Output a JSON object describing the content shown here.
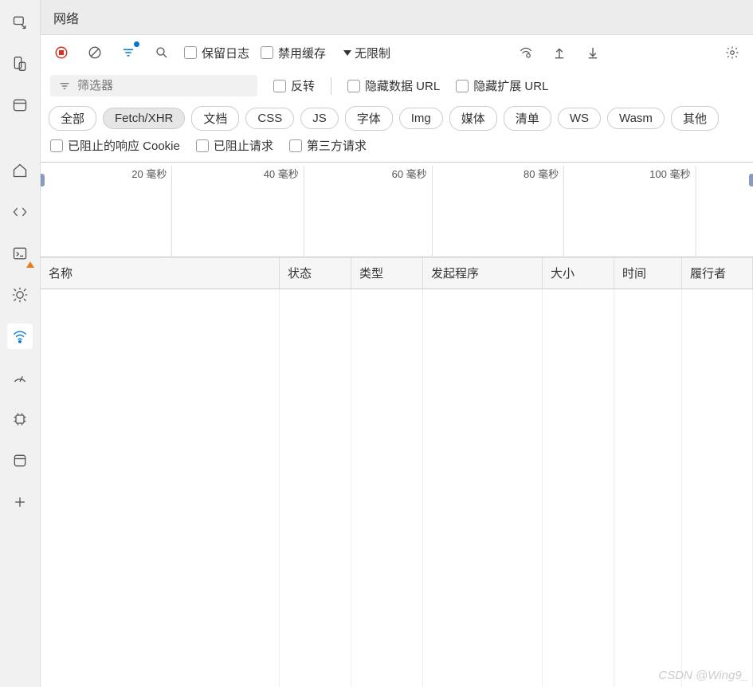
{
  "tab": {
    "title": "网络"
  },
  "toolbar": {
    "preserve_log": "保留日志",
    "disable_cache": "禁用缓存",
    "throttling": "无限制"
  },
  "filter": {
    "placeholder": "筛选器",
    "invert": "反转",
    "hide_data_urls": "隐藏数据 URL",
    "hide_ext_urls": "隐藏扩展 URL"
  },
  "types": [
    "全部",
    "Fetch/XHR",
    "文档",
    "CSS",
    "JS",
    "字体",
    "Img",
    "媒体",
    "清单",
    "WS",
    "Wasm",
    "其他"
  ],
  "types_active_index": 1,
  "extra_filters": {
    "blocked_cookies": "已阻止的响应 Cookie",
    "blocked_requests": "已阻止请求",
    "third_party": "第三方请求"
  },
  "timeline": {
    "ticks": [
      {
        "value": "20",
        "unit": "毫秒",
        "pct": 18.5
      },
      {
        "value": "40",
        "unit": "毫秒",
        "pct": 37
      },
      {
        "value": "60",
        "unit": "毫秒",
        "pct": 55
      },
      {
        "value": "80",
        "unit": "毫秒",
        "pct": 73.5
      },
      {
        "value": "100",
        "unit": "毫秒",
        "pct": 92
      }
    ]
  },
  "columns": {
    "name": "名称",
    "status": "状态",
    "type": "类型",
    "initiator": "发起程序",
    "size": "大小",
    "time": "时间",
    "fulfiller": "履行者"
  },
  "watermark": "CSDN @Wing9_"
}
